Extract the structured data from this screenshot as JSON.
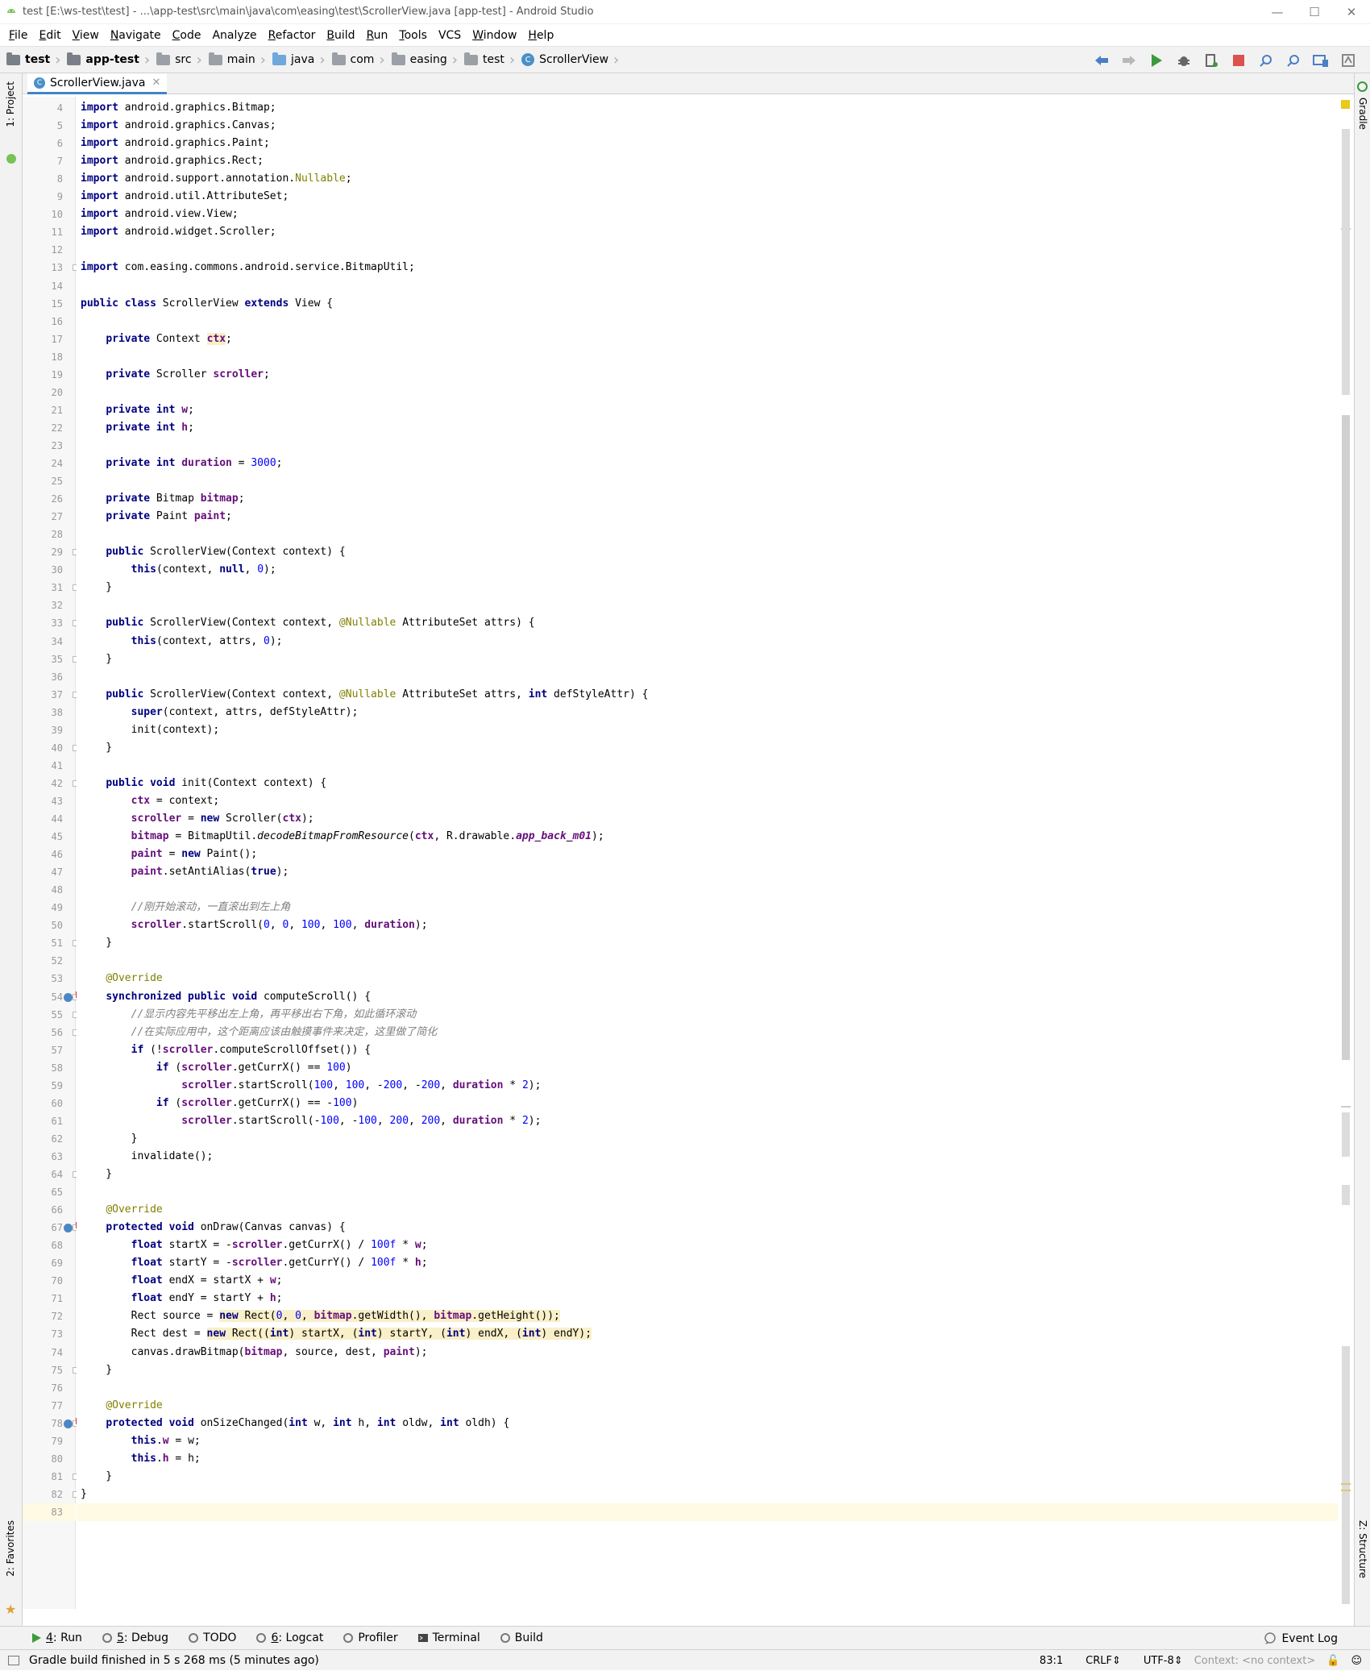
{
  "window": {
    "title": "test [E:\\ws-test\\test] - ...\\app-test\\src\\main\\java\\com\\easing\\test\\ScrollerView.java [app-test] - Android Studio",
    "minimize": "—",
    "maximize": "☐",
    "close": "✕"
  },
  "menu": {
    "items": [
      {
        "label": "File",
        "mnemonic": "F",
        "rest": "ile"
      },
      {
        "label": "Edit",
        "mnemonic": "E",
        "rest": "dit"
      },
      {
        "label": "View",
        "mnemonic": "V",
        "rest": "iew"
      },
      {
        "label": "Navigate",
        "mnemonic": "N",
        "rest": "avigate"
      },
      {
        "label": "Code",
        "mnemonic": "C",
        "rest": "ode"
      },
      {
        "label": "Analyze",
        "mnemonic": "",
        "rest": "Analyze"
      },
      {
        "label": "Refactor",
        "mnemonic": "R",
        "rest": "efactor"
      },
      {
        "label": "Build",
        "mnemonic": "B",
        "rest": "uild"
      },
      {
        "label": "Run",
        "mnemonic": "R",
        "rest": "un"
      },
      {
        "label": "Tools",
        "mnemonic": "T",
        "rest": "ools"
      },
      {
        "label": "VCS",
        "mnemonic": "",
        "rest": "VCS"
      },
      {
        "label": "Window",
        "mnemonic": "W",
        "rest": "indow"
      },
      {
        "label": "Help",
        "mnemonic": "H",
        "rest": "elp"
      }
    ]
  },
  "breadcrumb": {
    "items": [
      {
        "label": "test",
        "bold": true,
        "icon": "project-folder-icon",
        "color": "#7a8088"
      },
      {
        "label": "app-test",
        "bold": true,
        "icon": "module-folder-icon",
        "color": "#7a8088"
      },
      {
        "label": "src",
        "bold": false,
        "icon": "folder-icon",
        "color": "#9aa0a6"
      },
      {
        "label": "main",
        "bold": false,
        "icon": "folder-icon",
        "color": "#9aa0a6"
      },
      {
        "label": "java",
        "bold": false,
        "icon": "source-folder-icon",
        "color": "#6fa8dc"
      },
      {
        "label": "com",
        "bold": false,
        "icon": "package-icon",
        "color": "#9aa0a6"
      },
      {
        "label": "easing",
        "bold": false,
        "icon": "package-icon",
        "color": "#9aa0a6"
      },
      {
        "label": "test",
        "bold": false,
        "icon": "package-icon",
        "color": "#9aa0a6"
      }
    ],
    "class_label": "ScrollerView",
    "class_badge": "C"
  },
  "toolbar": {
    "icons": [
      "back-arrow-icon",
      "forward-arrow-icon",
      "run-icon",
      "debug-icon",
      "apply-changes-icon",
      "stop-icon",
      "search-icon",
      "find-icon",
      "device-manager-icon",
      "sdk-manager-icon"
    ]
  },
  "side_tabs": {
    "project": "1: Project",
    "favorites": "2: Favorites",
    "gradle": "Gradle",
    "structure": "Z: Structure"
  },
  "editor_tab": {
    "badge": "C",
    "label": "ScrollerView.java",
    "close": "✕"
  },
  "code": {
    "first_line": 4,
    "lines": [
      "<span class=\"kw\">import</span> android.graphics.Bitmap;",
      "<span class=\"kw\">import</span> android.graphics.Canvas;",
      "<span class=\"kw\">import</span> android.graphics.Paint;",
      "<span class=\"kw\">import</span> android.graphics.Rect;",
      "<span class=\"kw\">import</span> android.support.annotation.<span class=\"ann\">Nullable</span>;",
      "<span class=\"kw\">import</span> android.util.AttributeSet;",
      "<span class=\"kw\">import</span> android.view.View;",
      "<span class=\"kw\">import</span> android.widget.Scroller;",
      "",
      "<span class=\"kw\">import</span> com.easing.commons.android.service.BitmapUtil;",
      "",
      "<span class=\"kw\">public class</span> ScrollerView <span class=\"kw\">extends</span> View {",
      "",
      "    <span class=\"kw\">private</span> Context <span class=\"fld hl\">ctx</span>;",
      "",
      "    <span class=\"kw\">private</span> Scroller <span class=\"fld\">scroller</span>;",
      "",
      "    <span class=\"kw\">private int</span> <span class=\"fld\">w</span>;",
      "    <span class=\"kw\">private int</span> <span class=\"fld\">h</span>;",
      "",
      "    <span class=\"kw\">private int</span> <span class=\"fld\">duration</span> = <span class=\"num\">3000</span>;",
      "",
      "    <span class=\"kw\">private</span> Bitmap <span class=\"fld\">bitmap</span>;",
      "    <span class=\"kw\">private</span> Paint <span class=\"fld\">paint</span>;",
      "",
      "    <span class=\"kw\">public</span> ScrollerView(Context context) {",
      "        <span class=\"kw\">this</span>(context, <span class=\"kw\">null</span>, <span class=\"num\">0</span>);",
      "    }",
      "",
      "    <span class=\"kw\">public</span> ScrollerView(Context context, <span class=\"ann\">@Nullable</span> AttributeSet attrs) {",
      "        <span class=\"kw\">this</span>(context, attrs, <span class=\"num\">0</span>);",
      "    }",
      "",
      "    <span class=\"kw\">public</span> ScrollerView(Context context, <span class=\"ann\">@Nullable</span> AttributeSet attrs, <span class=\"kw\">int</span> defStyleAttr) {",
      "        <span class=\"kw\">super</span>(context, attrs, defStyleAttr);",
      "        init(context);",
      "    }",
      "",
      "    <span class=\"kw\">public void</span> init(Context context) {",
      "        <span class=\"fld\">ctx</span> = context;",
      "        <span class=\"fld\">scroller</span> = <span class=\"kw\">new</span> Scroller(<span class=\"fld\">ctx</span>);",
      "        <span class=\"fld\">bitmap</span> = BitmapUtil.<i>decodeBitmapFromResource</i>(<span class=\"fld\">ctx</span>, R.drawable.<span class=\"st\"><b>app_back_m01</b></span>);",
      "        <span class=\"fld\">paint</span> = <span class=\"kw\">new</span> Paint();",
      "        <span class=\"fld\">paint</span>.setAntiAlias(<span class=\"kw\">true</span>);",
      "",
      "        <span class=\"cmt\">//刚开始滚动，一直滚出到左上角</span>",
      "        <span class=\"fld\">scroller</span>.startScroll(<span class=\"num\">0</span>, <span class=\"num\">0</span>, <span class=\"num\">100</span>, <span class=\"num\">100</span>, <span class=\"fld\">duration</span>);",
      "    }",
      "",
      "    <span class=\"ann\">@Override</span>",
      "    <span class=\"kw\">synchronized public void</span> computeScroll() {",
      "        <span class=\"cmt\">//显示内容先平移出左上角，再平移出右下角，如此循环滚动</span>",
      "        <span class=\"cmt\">//在实际应用中，这个距离应该由触摸事件来决定，这里做了简化</span>",
      "        <span class=\"kw\">if</span> (!<span class=\"fld\">scroller</span>.computeScrollOffset()) {",
      "            <span class=\"kw\">if</span> (<span class=\"fld\">scroller</span>.getCurrX() == <span class=\"num\">100</span>)",
      "                <span class=\"fld\">scroller</span>.startScroll(<span class=\"num\">100</span>, <span class=\"num\">100</span>, -<span class=\"num\">200</span>, -<span class=\"num\">200</span>, <span class=\"fld\">duration</span> * <span class=\"num\">2</span>);",
      "            <span class=\"kw\">if</span> (<span class=\"fld\">scroller</span>.getCurrX() == -<span class=\"num\">100</span>)",
      "                <span class=\"fld\">scroller</span>.startScroll(-<span class=\"num\">100</span>, -<span class=\"num\">100</span>, <span class=\"num\">200</span>, <span class=\"num\">200</span>, <span class=\"fld\">duration</span> * <span class=\"num\">2</span>);",
      "        }",
      "        invalidate();",
      "    }",
      "",
      "    <span class=\"ann\">@Override</span>",
      "    <span class=\"kw\">protected void</span> onDraw(Canvas canvas) {",
      "        <span class=\"kw\">float</span> startX = -<span class=\"fld\">scroller</span>.getCurrX() / <span class=\"num\">100f</span> * <span class=\"fld\">w</span>;",
      "        <span class=\"kw\">float</span> startY = -<span class=\"fld\">scroller</span>.getCurrY() / <span class=\"num\">100f</span> * <span class=\"fld\">h</span>;",
      "        <span class=\"kw\">float</span> endX = startX + <span class=\"fld\">w</span>;",
      "        <span class=\"kw\">float</span> endY = startY + <span class=\"fld\">h</span>;",
      "        Rect source = <span class=\"hl\"><span class=\"kw\">new</span> Rect(<span class=\"num\">0</span>, <span class=\"num\">0</span>, <span class=\"fld\">bitmap</span>.getWidth(), <span class=\"fld\">bitmap</span>.getHeight());</span>",
      "        Rect dest = <span class=\"hl\"><span class=\"kw\">new</span> Rect((<span class=\"kw\">int</span>) startX, (<span class=\"kw\">int</span>) startY, (<span class=\"kw\">int</span>) endX, (<span class=\"kw\">int</span>) endY);</span>",
      "        canvas.drawBitmap(<span class=\"fld\">bitmap</span>, source, dest, <span class=\"fld\">paint</span>);",
      "    }",
      "",
      "    <span class=\"ann\">@Override</span>",
      "    <span class=\"kw\">protected void</span> onSizeChanged(<span class=\"kw\">int</span> w, <span class=\"kw\">int</span> h, <span class=\"kw\">int</span> oldw, <span class=\"kw\">int</span> oldh) {",
      "        <span class=\"kw\">this</span>.<span class=\"fld\">w</span> = w;",
      "        <span class=\"kw\">this</span>.<span class=\"fld\">h</span> = h;",
      "    }",
      "}",
      ""
    ],
    "fold_lines": [
      13,
      29,
      31,
      33,
      35,
      37,
      40,
      42,
      51,
      54,
      55,
      56,
      64,
      67,
      75,
      78,
      81,
      82
    ],
    "override_lines": [
      54,
      67,
      78
    ],
    "current_line": 83
  },
  "bottom_tools": [
    {
      "num": "4",
      "label": ": Run",
      "icon": "run-icon",
      "color": "#3c9a3c"
    },
    {
      "num": "5",
      "label": ": Debug",
      "icon": "debug-icon",
      "color": "#777777"
    },
    {
      "num": "",
      "label": "TODO",
      "icon": "todo-icon",
      "color": "#777777"
    },
    {
      "num": "6",
      "label": ": Logcat",
      "icon": "logcat-icon",
      "color": "#777777"
    },
    {
      "num": "",
      "label": "Profiler",
      "icon": "profiler-icon",
      "color": "#777777"
    },
    {
      "num": "",
      "label": "Terminal",
      "icon": "terminal-icon",
      "color": "#444444"
    },
    {
      "num": "",
      "label": "Build",
      "icon": "build-icon",
      "color": "#777777"
    }
  ],
  "event_log": "Event Log",
  "status": {
    "message": "Gradle build finished in 5 s 268 ms (5 minutes ago)",
    "position": "83:1",
    "line_sep": "CRLF",
    "encoding": "UTF-8",
    "context": "Context: <no context>"
  }
}
